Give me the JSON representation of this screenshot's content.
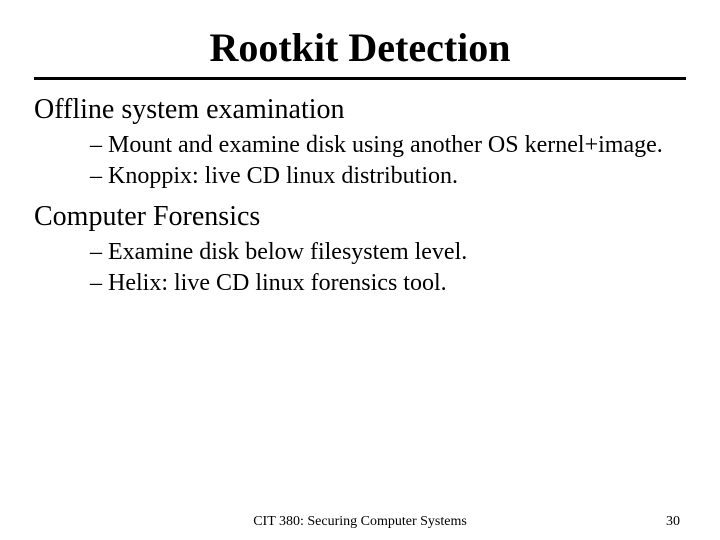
{
  "title": "Rootkit Detection",
  "sections": [
    {
      "heading": "Offline system examination",
      "bullets": [
        "– Mount and examine disk using another OS kernel+image.",
        "– Knoppix: live CD linux distribution."
      ]
    },
    {
      "heading": "Computer Forensics",
      "bullets": [
        "– Examine disk below filesystem level.",
        "– Helix: live CD linux forensics tool."
      ]
    }
  ],
  "footer": {
    "course": "CIT 380: Securing Computer Systems",
    "page": "30"
  }
}
